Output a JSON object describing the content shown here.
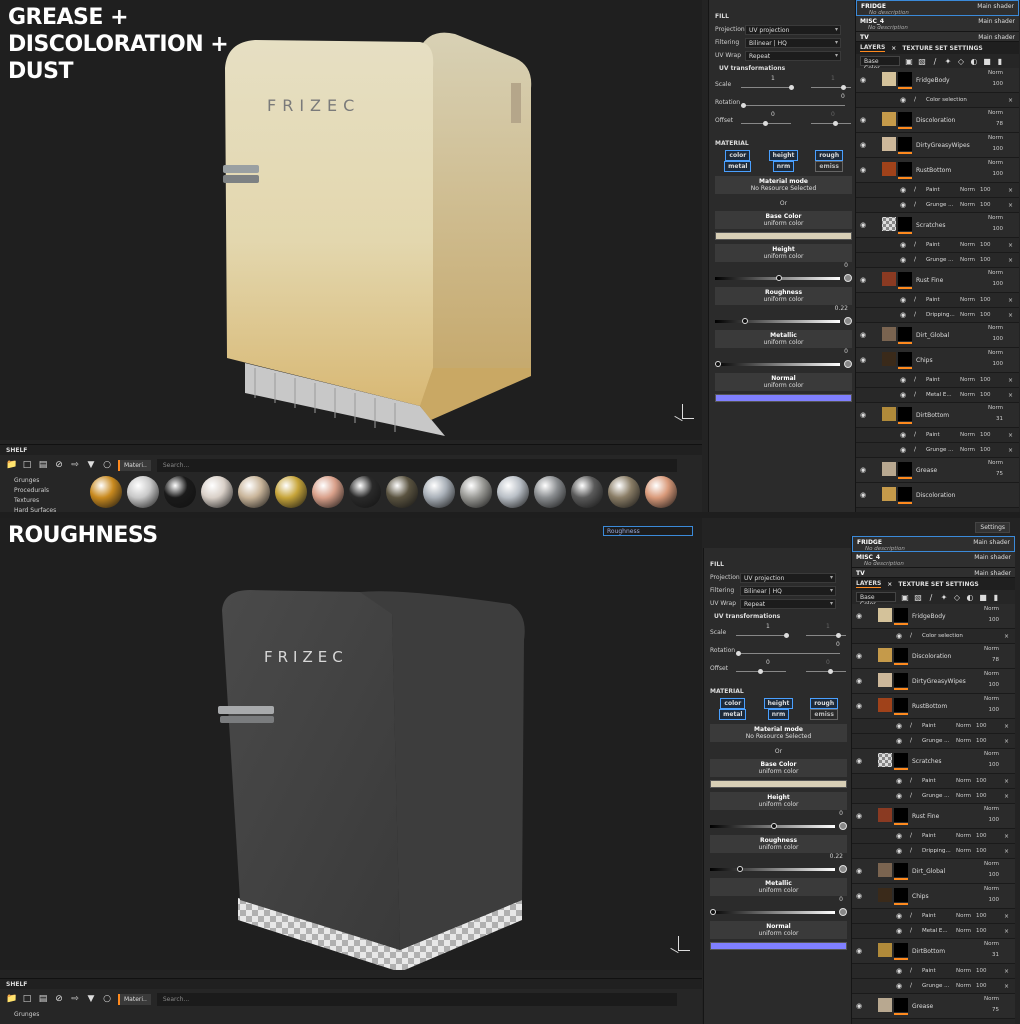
{
  "top": {
    "title": "GREASE +\nDISCOLORATION +\nDUST",
    "fridge_brand": "FRIZEC"
  },
  "bottom": {
    "title": "ROUGHNESS",
    "fridge_brand": "FRIZEC",
    "channel_select": "Roughness",
    "settings_label": "Settings"
  },
  "shelf": {
    "title": "SHELF",
    "tab_label": "Materi..",
    "search_placeholder": "Search...",
    "categories": [
      "Grunges",
      "Procedurals",
      "Textures",
      "Hard Surfaces"
    ],
    "bottom_categories": [
      "Grunges"
    ],
    "sphere_colors": [
      "#c98a1f",
      "#c9c9c9",
      "#1a1a1a",
      "#d9d0c8",
      "#c9b59a",
      "#c7a53a",
      "#d9a08a",
      "#2a2a2a",
      "#5a5340",
      "#a9b0b8",
      "#9a9a96",
      "#b9bfc6",
      "#8a8d90",
      "#5a5a5a",
      "#8a7d66",
      "#d99a7a"
    ]
  },
  "properties": {
    "fill_header": "FILL",
    "projection_label": "Projection",
    "projection_value": "UV projection",
    "filtering_label": "Filtering",
    "filtering_value": "Bilinear | HQ",
    "uvwrap_label": "UV Wrap",
    "uvwrap_value": "Repeat",
    "uvtransform_header": "UV transformations",
    "scale_label": "Scale",
    "scale_value": "1",
    "scale_value2": "1",
    "rotation_label": "Rotation",
    "rotation_value": "0",
    "offset_label": "Offset",
    "offset_value": "0",
    "offset_value2": "0",
    "material_header": "MATERIAL",
    "channels": [
      "color",
      "height",
      "rough",
      "metal",
      "nrm",
      "emiss"
    ],
    "material_mode": "Material mode",
    "no_resource": "No Resource Selected",
    "or": "Or",
    "base_color": "Base Color",
    "uniform": "uniform color",
    "base_color_hex": "#d8cfb6",
    "height": "Height",
    "height_value": "0",
    "height_fraction": 0.5,
    "roughness": "Roughness",
    "roughness_value": "0.22",
    "roughness_fraction": 0.22,
    "metallic": "Metallic",
    "metallic_value": "0",
    "metallic_fraction": 0,
    "normal": "Normal",
    "normal_hex": "#8080ff"
  },
  "layers": {
    "texture_sets": [
      {
        "name": "FRIDGE",
        "shader": "Main shader",
        "desc": "No description"
      },
      {
        "name": "MISC_4",
        "shader": "Main shader",
        "desc": "No description"
      },
      {
        "name": "TV",
        "shader": "Main shader"
      }
    ],
    "tab_layers": "LAYERS",
    "tab_tss": "TEXTURE SET SETTINGS",
    "channel": "Base Color",
    "items": [
      {
        "name": "FridgeBody",
        "blend": "Norm",
        "opacity": "100",
        "type": "folder",
        "color": "#d4c29a"
      },
      {
        "name": "Color selection",
        "type": "sub"
      },
      {
        "name": "Discoloration",
        "blend": "Norm",
        "opacity": "78",
        "color": "#c59a4a"
      },
      {
        "name": "DirtyGreasyWipes",
        "blend": "Norm",
        "opacity": "100",
        "color": "#cdb89a"
      },
      {
        "name": "RustBottom",
        "blend": "Norm",
        "opacity": "100",
        "color": "#a0421a"
      },
      {
        "name": "Paint",
        "blend": "Norm",
        "opacity": "100",
        "type": "sub"
      },
      {
        "name": "Grunge ...",
        "blend": "Norm",
        "opacity": "100",
        "type": "sub"
      },
      {
        "name": "Scratches",
        "blend": "Norm",
        "opacity": "100",
        "color": "checker"
      },
      {
        "name": "Paint",
        "blend": "Norm",
        "opacity": "100",
        "type": "sub"
      },
      {
        "name": "Grunge ...",
        "blend": "Norm",
        "opacity": "100",
        "type": "sub"
      },
      {
        "name": "Rust Fine",
        "blend": "Norm",
        "opacity": "100",
        "color": "#8a3a22"
      },
      {
        "name": "Paint",
        "blend": "Norm",
        "opacity": "100",
        "type": "sub"
      },
      {
        "name": "Dripping...",
        "blend": "Norm",
        "opacity": "100",
        "type": "sub"
      },
      {
        "name": "Dirt_Global",
        "blend": "Norm",
        "opacity": "100",
        "color": "#7a6450"
      },
      {
        "name": "Chips",
        "blend": "Norm",
        "opacity": "100",
        "color": "#3a2a1a"
      },
      {
        "name": "Paint",
        "blend": "Norm",
        "opacity": "100",
        "type": "sub"
      },
      {
        "name": "Metal E...",
        "blend": "Norm",
        "opacity": "100",
        "type": "sub"
      },
      {
        "name": "DirtBottom",
        "blend": "Norm",
        "opacity": "31",
        "color": "#b08a3a"
      },
      {
        "name": "Paint",
        "blend": "Norm",
        "opacity": "100",
        "type": "sub"
      },
      {
        "name": "Grunge ...",
        "blend": "Norm",
        "opacity": "100",
        "type": "sub"
      },
      {
        "name": "Grease",
        "blend": "Norm",
        "opacity": "75",
        "color": "#b8a890"
      },
      {
        "name": "Discoloration",
        "color": "#c59a4a"
      }
    ]
  }
}
